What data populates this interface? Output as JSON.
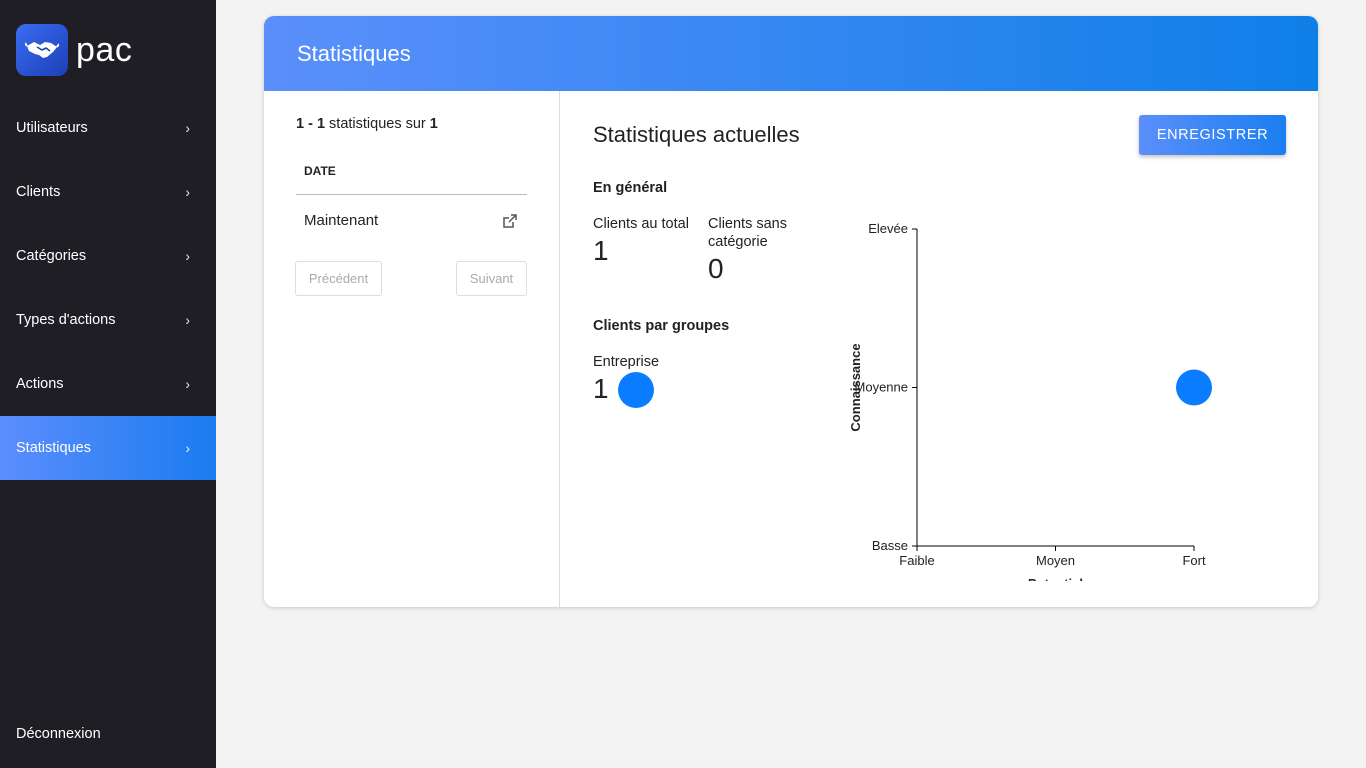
{
  "app": {
    "name": "pac"
  },
  "sidebar": {
    "items": [
      {
        "label": "Utilisateurs"
      },
      {
        "label": "Clients"
      },
      {
        "label": "Catégories"
      },
      {
        "label": "Types d'actions"
      },
      {
        "label": "Actions"
      },
      {
        "label": "Statistiques"
      }
    ],
    "active": "Statistiques",
    "logout_label": "Déconnexion"
  },
  "card": {
    "title": "Statistiques"
  },
  "list": {
    "range": "1 - 1",
    "middle_text": "statistiques sur",
    "total": "1",
    "column_header": "DATE",
    "rows": [
      {
        "date": "Maintenant"
      }
    ],
    "prev_label": "Précédent",
    "next_label": "Suivant"
  },
  "current": {
    "title": "Statistiques actuelles",
    "save_label": "ENREGISTRER",
    "general_heading": "En général",
    "total_label": "Clients au total",
    "total_value": "1",
    "no_category_label": "Clients sans catégorie",
    "no_category_value": "0",
    "groups_heading": "Clients par groupes",
    "groups": [
      {
        "name": "Entreprise",
        "count": "1"
      }
    ]
  },
  "chart_data": {
    "type": "scatter",
    "xlabel": "Potentiel",
    "ylabel": "Connaissance",
    "x_categories": [
      "Faible",
      "Moyen",
      "Fort"
    ],
    "y_categories": [
      "Basse",
      "Moyenne",
      "Elevée"
    ],
    "points": [
      {
        "x": "Fort",
        "y": "Moyenne"
      }
    ],
    "point_color": "#0a7cff",
    "grid": false
  }
}
